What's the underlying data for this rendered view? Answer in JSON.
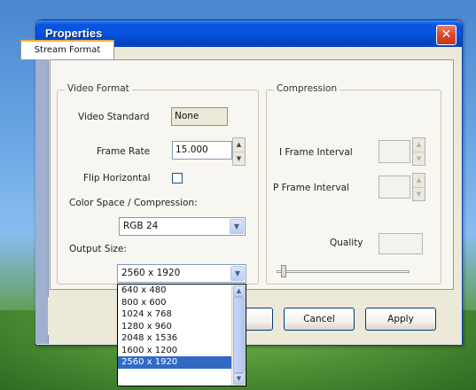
{
  "window": {
    "title": "Properties",
    "close_glyph": "✕"
  },
  "tabs": [
    {
      "label": "Stream Format",
      "active": true
    }
  ],
  "video_format": {
    "legend": "Video Format",
    "video_standard": {
      "label": "Video Standard",
      "value": "None"
    },
    "frame_rate": {
      "label": "Frame Rate",
      "value": "15.000"
    },
    "flip_horizontal": {
      "label": "Flip Horizontal",
      "checked": false
    },
    "color_space": {
      "label": "Color Space / Compression:",
      "value": "RGB 24"
    },
    "output_size": {
      "label": "Output Size:",
      "value": "2560 x 1920"
    }
  },
  "compression": {
    "legend": "Compression",
    "i_frame_interval": {
      "label": "I Frame Interval",
      "value": ""
    },
    "p_frame_interval": {
      "label": "P Frame Interval",
      "value": ""
    },
    "quality": {
      "label": "Quality",
      "value": "",
      "slider_level": 0.05
    }
  },
  "output_size_options": [
    "640 x 480",
    "800 x 600",
    "1024 x 768",
    "1280 x 960",
    "2048 x 1536",
    "1600 x 1200",
    "2560 x 1920"
  ],
  "selected_option_index": 6,
  "buttons": {
    "ok": "",
    "cancel": "Cancel",
    "apply": "Apply"
  },
  "icons": {
    "close": "close-icon",
    "combo_arrow": "chevron-down-icon",
    "spin_up": "arrow-up-icon",
    "spin_down": "arrow-down-icon"
  },
  "colors": {
    "titlebar": "#0553e0",
    "close_button": "#d9482a",
    "selection": "#316ac5",
    "tab_highlight": "#f3b13d"
  }
}
